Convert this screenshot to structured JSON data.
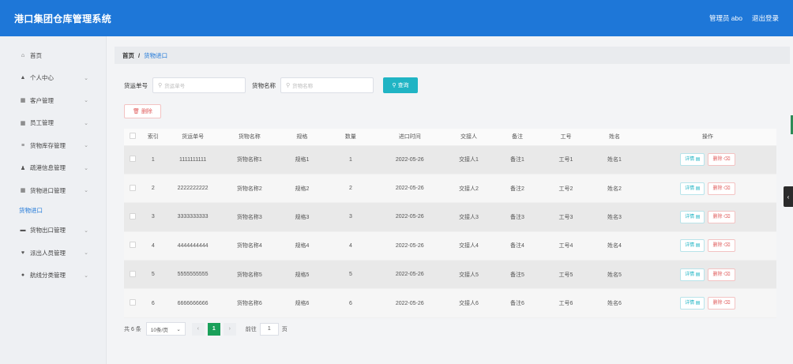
{
  "header": {
    "title": "港口集团仓库管理系统",
    "admin": "管理员 abo",
    "logout": "退出登录"
  },
  "sidebar": {
    "items": [
      {
        "icon": "home-icon",
        "glyph": "⌂",
        "label": "首页",
        "arrow": ""
      },
      {
        "icon": "user-icon",
        "glyph": "▲",
        "label": "个人中心",
        "arrow": "⌄"
      },
      {
        "icon": "grid-icon",
        "glyph": "▦",
        "label": "客户管理",
        "arrow": "⌄"
      },
      {
        "icon": "grid-icon",
        "glyph": "▦",
        "label": "员工管理",
        "arrow": "⌄"
      },
      {
        "icon": "list-icon",
        "glyph": "≡",
        "label": "货物库存管理",
        "arrow": "⌄"
      },
      {
        "icon": "person-icon",
        "glyph": "♟",
        "label": "疏港信息管理",
        "arrow": "⌄"
      },
      {
        "icon": "grid-icon",
        "glyph": "▦",
        "label": "货物进口管理",
        "arrow": "⌄"
      }
    ],
    "sub_item": "货物进口",
    "items_after": [
      {
        "icon": "box-icon",
        "glyph": "▬",
        "label": "货物出口管理",
        "arrow": "⌄"
      },
      {
        "icon": "shield-icon",
        "glyph": "♥",
        "label": "派出人员管理",
        "arrow": "⌄"
      },
      {
        "icon": "pin-icon",
        "glyph": "●",
        "label": "航线分类管理",
        "arrow": "⌄"
      }
    ]
  },
  "breadcrumb": {
    "home": "首页",
    "sep": "/",
    "current": "货物进口"
  },
  "search": {
    "label1": "货运单号",
    "placeholder1": "货运单号",
    "label2": "货物名称",
    "placeholder2": "货物名称",
    "query": "查询"
  },
  "delete_button": "删除",
  "table": {
    "headers": [
      "",
      "索引",
      "货运单号",
      "货物名称",
      "规格",
      "数量",
      "进口时间",
      "交接人",
      "备注",
      "工号",
      "姓名",
      "操作"
    ],
    "rows": [
      [
        "1",
        "1111111111",
        "货物名称1",
        "规格1",
        "1",
        "2022-05-26",
        "交接人1",
        "备注1",
        "工号1",
        "姓名1"
      ],
      [
        "2",
        "2222222222",
        "货物名称2",
        "规格2",
        "2",
        "2022-05-26",
        "交接人2",
        "备注2",
        "工号2",
        "姓名2"
      ],
      [
        "3",
        "3333333333",
        "货物名称3",
        "规格3",
        "3",
        "2022-05-26",
        "交接人3",
        "备注3",
        "工号3",
        "姓名3"
      ],
      [
        "4",
        "4444444444",
        "货物名称4",
        "规格4",
        "4",
        "2022-05-26",
        "交接人4",
        "备注4",
        "工号4",
        "姓名4"
      ],
      [
        "5",
        "5555555555",
        "货物名称5",
        "规格5",
        "5",
        "2022-05-26",
        "交接人5",
        "备注5",
        "工号5",
        "姓名5"
      ],
      [
        "6",
        "6666666666",
        "货物名称6",
        "规格6",
        "6",
        "2022-05-26",
        "交接人6",
        "备注6",
        "工号6",
        "姓名6"
      ]
    ],
    "detail_label": "详情",
    "delete_label": "删除"
  },
  "pager": {
    "total": "共 6 条",
    "page_size": "10条/页",
    "current_page": "1",
    "goto_label": "前往",
    "goto_value": "1",
    "page_unit": "页"
  },
  "colors": {
    "header_bg": "#1e77d8",
    "query_btn": "#20b4c4",
    "current_page": "#1aa05a",
    "delete_red": "#e05d5d"
  }
}
